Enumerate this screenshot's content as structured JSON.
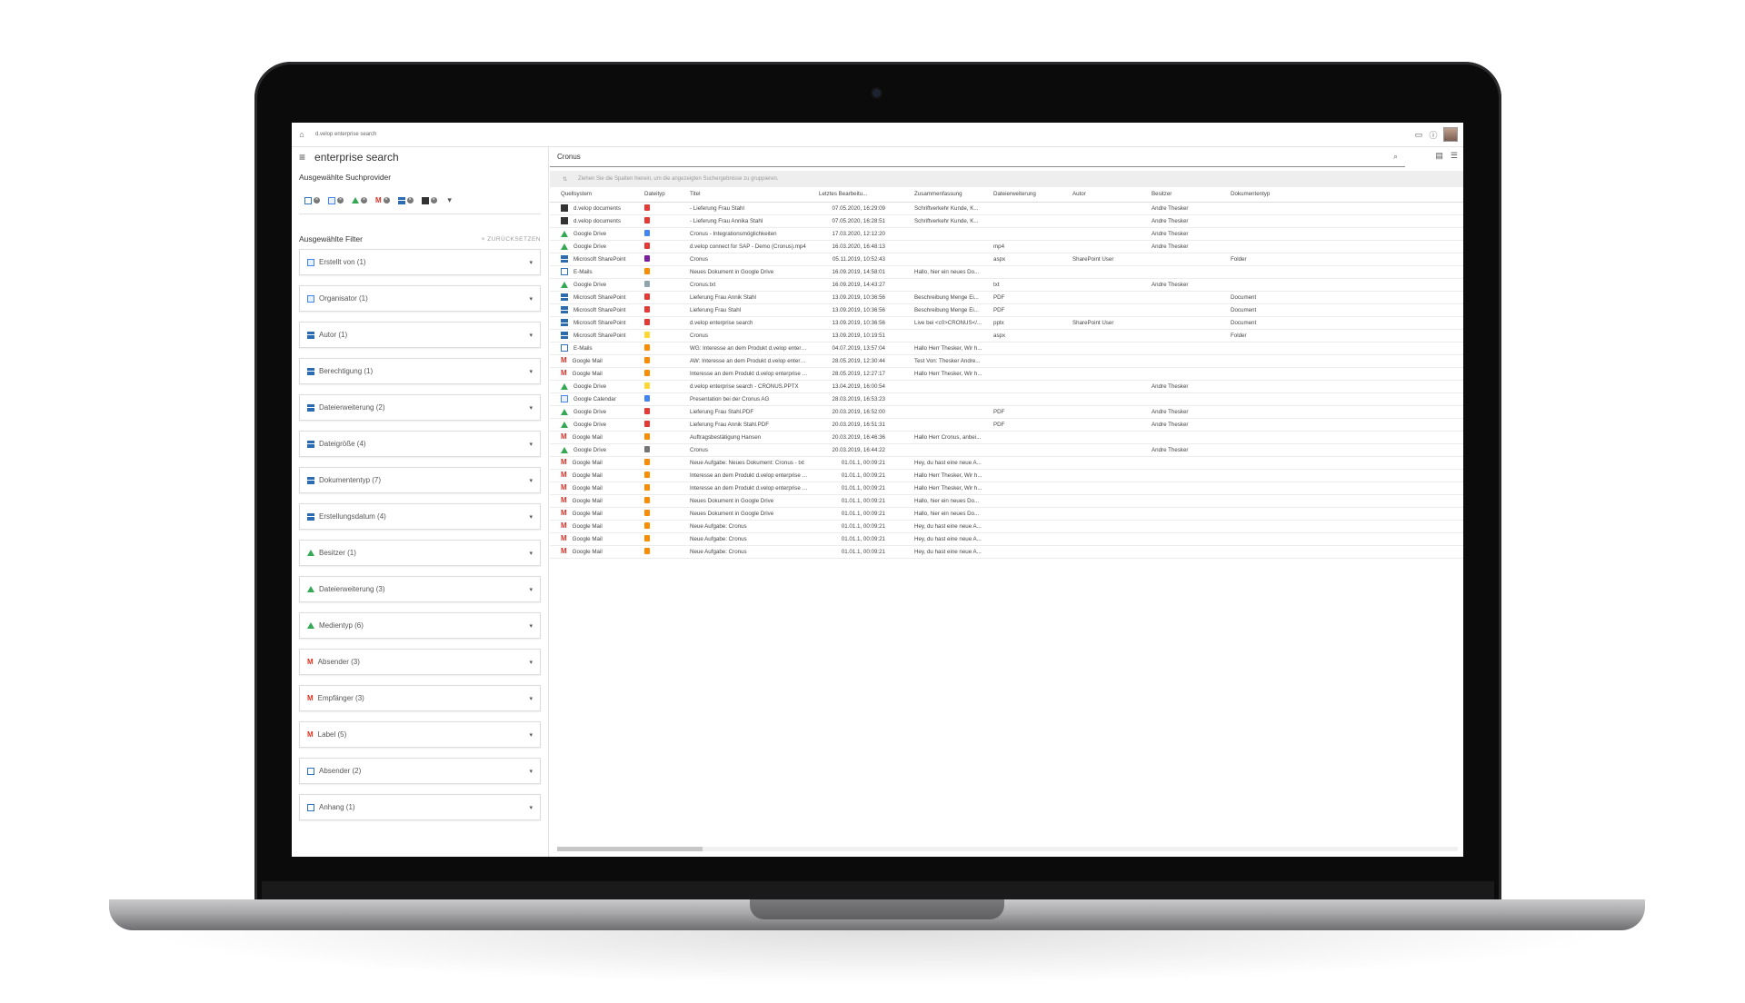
{
  "app": {
    "breadcrumb": "d.velop enterprise search",
    "title": "enterprise search",
    "search_query": "Cronus"
  },
  "sidebar": {
    "providers_label": "Ausgewählte Suchprovider",
    "filters_label": "Ausgewählte Filter",
    "reset_label": "ZURÜCKSETZEN",
    "filters": [
      {
        "label": "Erstellt von (1)",
        "icon": "calendar-icon"
      },
      {
        "label": "Organisator (1)",
        "icon": "calendar-icon"
      },
      {
        "label": "Autor (1)",
        "icon": "sharepoint-icon"
      },
      {
        "label": "Berechtigung (1)",
        "icon": "sharepoint-icon"
      },
      {
        "label": "Dateierweiterung (2)",
        "icon": "sharepoint-icon"
      },
      {
        "label": "Dateigröße (4)",
        "icon": "sharepoint-icon"
      },
      {
        "label": "Dokumententyp (7)",
        "icon": "sharepoint-icon"
      },
      {
        "label": "Erstellungsdatum (4)",
        "icon": "sharepoint-icon"
      },
      {
        "label": "Besitzer (1)",
        "icon": "google-drive-icon"
      },
      {
        "label": "Dateierweiterung (3)",
        "icon": "google-drive-icon"
      },
      {
        "label": "Medientyp (6)",
        "icon": "google-drive-icon"
      },
      {
        "label": "Absender (3)",
        "icon": "gmail-icon"
      },
      {
        "label": "Empfänger (3)",
        "icon": "gmail-icon"
      },
      {
        "label": "Label (5)",
        "icon": "gmail-icon"
      },
      {
        "label": "Absender (2)",
        "icon": "mail-icon"
      },
      {
        "label": "Anhang (1)",
        "icon": "mail-icon"
      }
    ]
  },
  "results": {
    "group_hint": "Ziehen Sie die Spalten hierein, um die angezeigten Suchergebnisse zu gruppieren.",
    "columns": [
      "Quellsystem",
      "Dateityp",
      "Titel",
      "Letztes Bearbeitu...",
      "Zusammenfassung",
      "Dateierweiterung",
      "Autor",
      "Besitzer",
      "Dokumententyp"
    ],
    "rows": [
      {
        "source": "d.velop documents",
        "icon": "dvelop",
        "ftype": "#e53935",
        "title": "- Lieferung Frau Stahl",
        "date": "07.05.2020, 16:29:09",
        "summary": "Schriftverkehr Kunde, K...",
        "ext": "",
        "author": "",
        "owner": "Andre Thesker",
        "doctype": ""
      },
      {
        "source": "d.velop documents",
        "icon": "dvelop",
        "ftype": "#e53935",
        "title": "- Lieferung Frau Annika Stahl",
        "date": "07.05.2020, 16:28:51",
        "summary": "Schriftverkehr Kunde, K...",
        "ext": "",
        "author": "",
        "owner": "Andre Thesker",
        "doctype": ""
      },
      {
        "source": "Google Drive",
        "icon": "gdrive",
        "ftype": "#4285f4",
        "title": "Cronus - Integrationsmöglichkeiten",
        "date": "17.03.2020, 12:12:20",
        "summary": "",
        "ext": "",
        "author": "",
        "owner": "Andre Thesker",
        "doctype": ""
      },
      {
        "source": "Google Drive",
        "icon": "gdrive",
        "ftype": "#e53935",
        "title": "d.velop connect for SAP - Demo (Cronus).mp4",
        "date": "16.03.2020, 16:48:13",
        "summary": "",
        "ext": "mp4",
        "author": "",
        "owner": "Andre Thesker",
        "doctype": ""
      },
      {
        "source": "Microsoft SharePoint",
        "icon": "ms",
        "ftype": "#7b1fa2",
        "title": "Cronus",
        "date": "05.11.2019, 10:52:43",
        "summary": "",
        "ext": "aspx",
        "author": "SharePoint User",
        "owner": "",
        "doctype": "Folder"
      },
      {
        "source": "E-Mails",
        "icon": "mail",
        "ftype": "#fb8c00",
        "title": "Neues Dokument in Google Drive",
        "date": "16.09.2019, 14:58:01",
        "summary": "Hallo, hier ein neues Do...",
        "ext": "",
        "author": "",
        "owner": "",
        "doctype": ""
      },
      {
        "source": "Google Drive",
        "icon": "gdrive",
        "ftype": "#90a4ae",
        "title": "Cronus.txt",
        "date": "16.09.2019, 14:43:27",
        "summary": "",
        "ext": "txt",
        "author": "",
        "owner": "Andre Thesker",
        "doctype": ""
      },
      {
        "source": "Microsoft SharePoint",
        "icon": "ms",
        "ftype": "#e53935",
        "title": "Lieferung Frau Annik Stahl",
        "date": "13.09.2019, 10:36:56",
        "summary": "Beschreibung Menge Ei...",
        "ext": "PDF",
        "author": "",
        "owner": "",
        "doctype": "Document"
      },
      {
        "source": "Microsoft SharePoint",
        "icon": "ms",
        "ftype": "#e53935",
        "title": "Lieferung Frau Stahl",
        "date": "13.09.2019, 10:36:56",
        "summary": "Beschreibung Menge Ei...",
        "ext": "PDF",
        "author": "",
        "owner": "",
        "doctype": "Document"
      },
      {
        "source": "Microsoft SharePoint",
        "icon": "ms",
        "ftype": "#e53935",
        "title": "d.velop enterprise search",
        "date": "13.09.2019, 10:36:56",
        "summary": "Live bei <c0>CRONUS</...",
        "ext": "pptx",
        "author": "SharePoint User",
        "owner": "",
        "doctype": "Document"
      },
      {
        "source": "Microsoft SharePoint",
        "icon": "ms",
        "ftype": "#fdd835",
        "title": "Cronus",
        "date": "13.09.2019, 10:19:51",
        "summary": "",
        "ext": "aspx",
        "author": "",
        "owner": "",
        "doctype": "Folder"
      },
      {
        "source": "E-Mails",
        "icon": "mail",
        "ftype": "#fb8c00",
        "title": "WG: Interesse an dem Produkt d.velop enterpr...",
        "date": "04.07.2019, 13:57:04",
        "summary": "Hallo Herr Thesker, Wir h...",
        "ext": "",
        "author": "",
        "owner": "",
        "doctype": ""
      },
      {
        "source": "Google Mail",
        "icon": "gmail",
        "ftype": "#fb8c00",
        "title": "AW: Interesse an dem Produkt d.velop enterpri...",
        "date": "28.05.2019, 12:30:44",
        "summary": "Test Von: Thesker Andre...",
        "ext": "",
        "author": "",
        "owner": "",
        "doctype": ""
      },
      {
        "source": "Google Mail",
        "icon": "gmail",
        "ftype": "#fb8c00",
        "title": "Interesse an dem Produkt d.velop enterprise s...",
        "date": "28.05.2019, 12:27:17",
        "summary": "Hallo Herr Thesker, Wir h...",
        "ext": "",
        "author": "",
        "owner": "",
        "doctype": ""
      },
      {
        "source": "Google Drive",
        "icon": "gdrive",
        "ftype": "#fdd835",
        "title": "d.velop enterprise search - CRONUS.PPTX",
        "date": "13.04.2019, 16:00:54",
        "summary": "",
        "ext": "",
        "author": "",
        "owner": "Andre Thesker",
        "doctype": ""
      },
      {
        "source": "Google Calendar",
        "icon": "cal",
        "ftype": "#4285f4",
        "title": "Presentation bei der Cronus AG",
        "date": "28.03.2019, 16:53:23",
        "summary": "",
        "ext": "",
        "author": "",
        "owner": "",
        "doctype": ""
      },
      {
        "source": "Google Drive",
        "icon": "gdrive",
        "ftype": "#e53935",
        "title": "Lieferung Frau Stahl.PDF",
        "date": "20.03.2019, 16:52:00",
        "summary": "",
        "ext": "PDF",
        "author": "",
        "owner": "Andre Thesker",
        "doctype": ""
      },
      {
        "source": "Google Drive",
        "icon": "gdrive",
        "ftype": "#e53935",
        "title": "Lieferung Frau Annik Stahl.PDF",
        "date": "20.03.2019, 16:51:31",
        "summary": "",
        "ext": "PDF",
        "author": "",
        "owner": "Andre Thesker",
        "doctype": ""
      },
      {
        "source": "Google Mail",
        "icon": "gmail",
        "ftype": "#fb8c00",
        "title": "Auftragsbestätigung Hansen",
        "date": "20.03.2019, 16:46:36",
        "summary": "Hallo Herr Cronus, anbei...",
        "ext": "",
        "author": "",
        "owner": "",
        "doctype": ""
      },
      {
        "source": "Google Drive",
        "icon": "gdrive",
        "ftype": "#757575",
        "title": "Cronus",
        "date": "20.03.2019, 16:44:22",
        "summary": "",
        "ext": "",
        "author": "",
        "owner": "Andre Thesker",
        "doctype": ""
      },
      {
        "source": "Google Mail",
        "icon": "gmail",
        "ftype": "#fb8c00",
        "title": "Neue Aufgabe: Neues Dokument: Cronus - txt",
        "date": "01.01.1, 00:09:21",
        "summary": "Hey, du hast eine neue A...",
        "ext": "",
        "author": "",
        "owner": "",
        "doctype": ""
      },
      {
        "source": "Google Mail",
        "icon": "gmail",
        "ftype": "#fb8c00",
        "title": "Interesse an dem Produkt d.velop enterprise s...",
        "date": "01.01.1, 00:09:21",
        "summary": "Hallo Herr Thesker, Wir h...",
        "ext": "",
        "author": "",
        "owner": "",
        "doctype": ""
      },
      {
        "source": "Google Mail",
        "icon": "gmail",
        "ftype": "#fb8c00",
        "title": "Interesse an dem Produkt d.velop enterprise s...",
        "date": "01.01.1, 00:09:21",
        "summary": "Hallo Herr Thesker, Wir h...",
        "ext": "",
        "author": "",
        "owner": "",
        "doctype": ""
      },
      {
        "source": "Google Mail",
        "icon": "gmail",
        "ftype": "#fb8c00",
        "title": "Neues Dokument in Google Drive",
        "date": "01.01.1, 00:09:21",
        "summary": "Hallo, hier ein neues Do...",
        "ext": "",
        "author": "",
        "owner": "",
        "doctype": ""
      },
      {
        "source": "Google Mail",
        "icon": "gmail",
        "ftype": "#fb8c00",
        "title": "Neues Dokument in Google Drive",
        "date": "01.01.1, 00:09:21",
        "summary": "Hallo, hier ein neues Do...",
        "ext": "",
        "author": "",
        "owner": "",
        "doctype": ""
      },
      {
        "source": "Google Mail",
        "icon": "gmail",
        "ftype": "#fb8c00",
        "title": "Neue Aufgabe: Cronus",
        "date": "01.01.1, 00:09:21",
        "summary": "Hey, du hast eine neue A...",
        "ext": "",
        "author": "",
        "owner": "",
        "doctype": ""
      },
      {
        "source": "Google Mail",
        "icon": "gmail",
        "ftype": "#fb8c00",
        "title": "Neue Aufgabe: Cronus",
        "date": "01.01.1, 00:09:21",
        "summary": "Hey, du hast eine neue A...",
        "ext": "",
        "author": "",
        "owner": "",
        "doctype": ""
      },
      {
        "source": "Google Mail",
        "icon": "gmail",
        "ftype": "#fb8c00",
        "title": "Neue Aufgabe: Cronus",
        "date": "01.01.1, 00:09:21",
        "summary": "Hey, du hast eine neue A...",
        "ext": "",
        "author": "",
        "owner": "",
        "doctype": ""
      }
    ]
  }
}
